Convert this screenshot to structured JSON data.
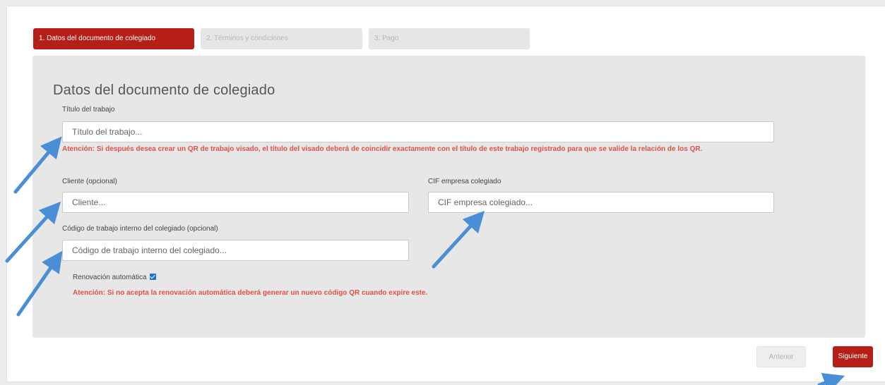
{
  "steps": [
    {
      "label": "1. Datos del documento de colegiado",
      "active": true
    },
    {
      "label": "2. Términos y condiciones",
      "active": false
    },
    {
      "label": "3. Pago",
      "active": false
    }
  ],
  "form": {
    "title": "Datos del documento de colegiado",
    "titulo": {
      "label": "Título del trabajo",
      "placeholder": "Título del trabajo..."
    },
    "titulo_warning": "Atención: Si después desea crear un QR de trabajo visado, el título del visado deberá de coincidir exactamente con el título de este trabajo registrado para que se valide la relación de los QR.",
    "cliente": {
      "label": "Cliente (opcional)",
      "placeholder": "Cliente..."
    },
    "cif": {
      "label": "CIF empresa colegiado",
      "placeholder": "CIF empresa colegiado..."
    },
    "codigo": {
      "label": "Código de trabajo interno del colegiado (opcional)",
      "placeholder": "Código de trabajo interno del colegiado..."
    },
    "renovacion": {
      "label": "Renovación automática",
      "checked": true
    },
    "renovacion_warning": "Atención: Si no acepta la renovación automática deberá generar un nuevo código QR cuando expire este."
  },
  "buttons": {
    "prev": "Anterior",
    "next": "Siguiente"
  },
  "colors": {
    "brand": "#b51f18",
    "warning": "#e0504a",
    "annotation_arrow": "#4a8fd6",
    "checkbox": "#1f6fd6"
  }
}
